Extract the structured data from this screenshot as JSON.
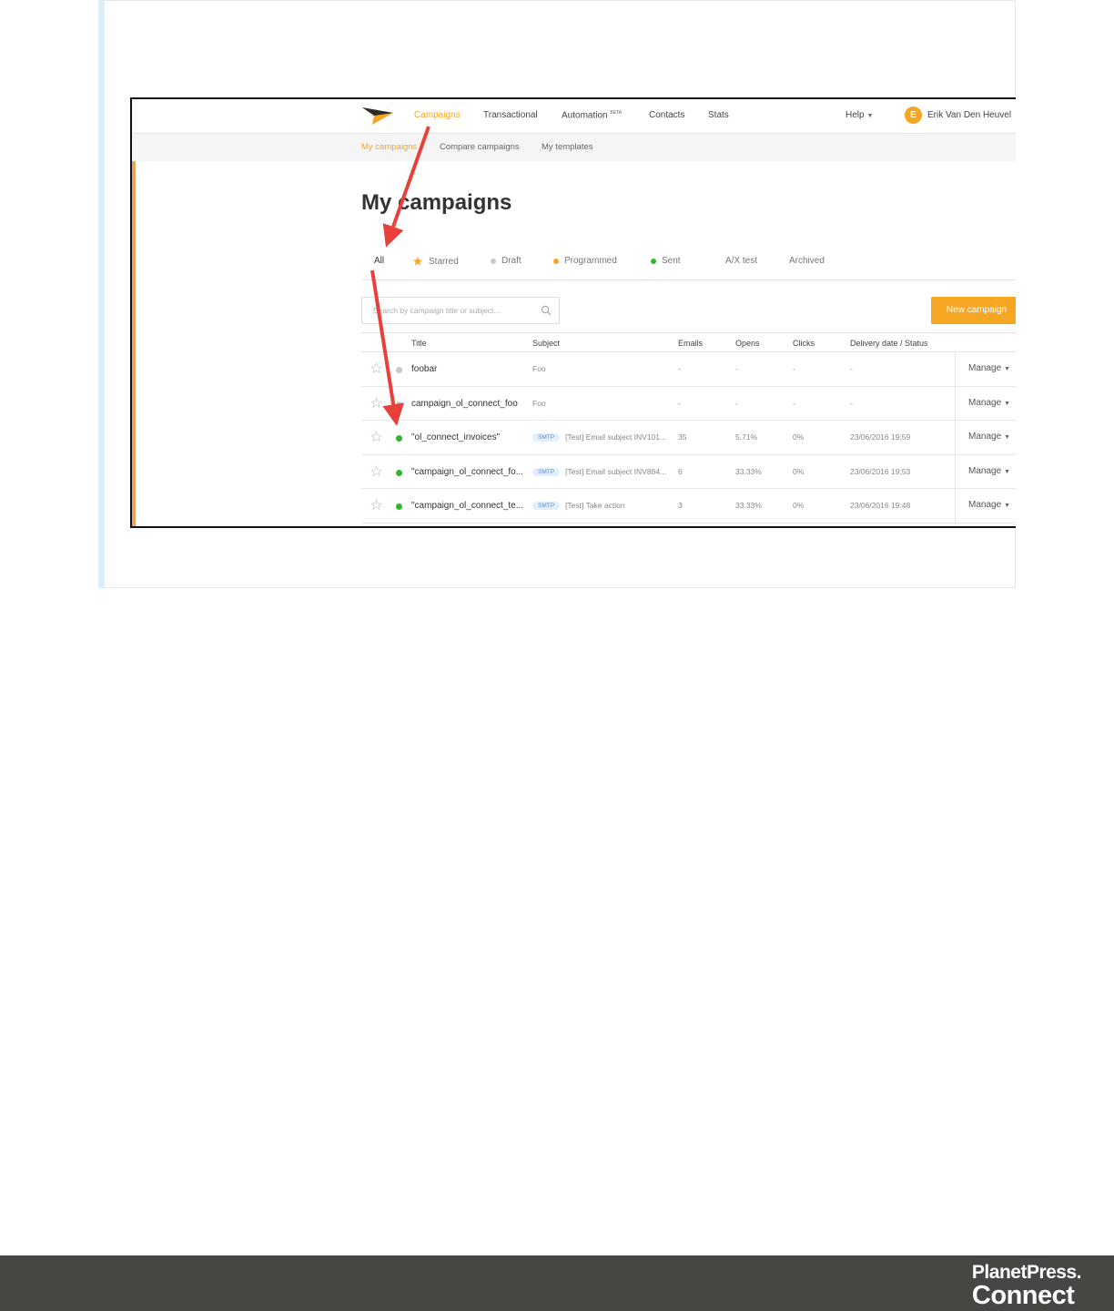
{
  "nav": {
    "items": [
      "Campaigns",
      "Transactional",
      "Automation",
      "Contacts",
      "Stats"
    ],
    "automation_badge": "BETA",
    "help": "Help",
    "user_initial": "E",
    "user_name": "Erik Van Den Heuvel"
  },
  "subnav": [
    "My campaigns",
    "Compare campaigns",
    "My templates"
  ],
  "page_title": "My campaigns",
  "filters": [
    {
      "label": "All"
    },
    {
      "label": "Starred"
    },
    {
      "label": "Draft"
    },
    {
      "label": "Programmed"
    },
    {
      "label": "Sent"
    },
    {
      "label": "A/X test"
    },
    {
      "label": "Archived"
    }
  ],
  "search": {
    "placeholder": "Search by campaign title or subject..."
  },
  "new_campaign_label": "New campaign",
  "table": {
    "headers": [
      "Title",
      "Subject",
      "Emails",
      "Opens",
      "Clicks",
      "Delivery date / Status"
    ],
    "manage_label": "Manage",
    "rows": [
      {
        "title": "foobar",
        "badge": "",
        "subject": "Foo",
        "emails": "-",
        "opens": "-",
        "clicks": "-",
        "date": "-",
        "status": "draft"
      },
      {
        "title": "campaign_ol_connect_foo",
        "badge": "",
        "subject": "Foo",
        "emails": "-",
        "opens": "-",
        "clicks": "-",
        "date": "-",
        "status": "draft"
      },
      {
        "title": "\"ol_connect_invoices\"",
        "badge": "SMTP",
        "subject": "[Test] Email subject INV101...",
        "emails": "35",
        "opens": "5.71%",
        "clicks": "0%",
        "date": "23/06/2016 19:59",
        "status": "sent"
      },
      {
        "title": "\"campaign_ol_connect_fo...",
        "badge": "SMTP",
        "subject": "[Test] Email subject INV884...",
        "emails": "6",
        "opens": "33.33%",
        "clicks": "0%",
        "date": "23/06/2016 19:53",
        "status": "sent"
      },
      {
        "title": "\"campaign_ol_connect_te...",
        "badge": "SMTP",
        "subject": "[Test] Take action",
        "emails": "3",
        "opens": "33.33%",
        "clicks": "0%",
        "date": "23/06/2016 19:48",
        "status": "sent"
      }
    ]
  },
  "footer": {
    "brand_line1": "PlanetPress.",
    "brand_line2": "Connect"
  },
  "colors": {
    "accent": "#f5a623",
    "sent": "#2eb82e",
    "draft": "#c8c8c8",
    "arrow": "#e8403a",
    "footer_bg": "#474643"
  }
}
